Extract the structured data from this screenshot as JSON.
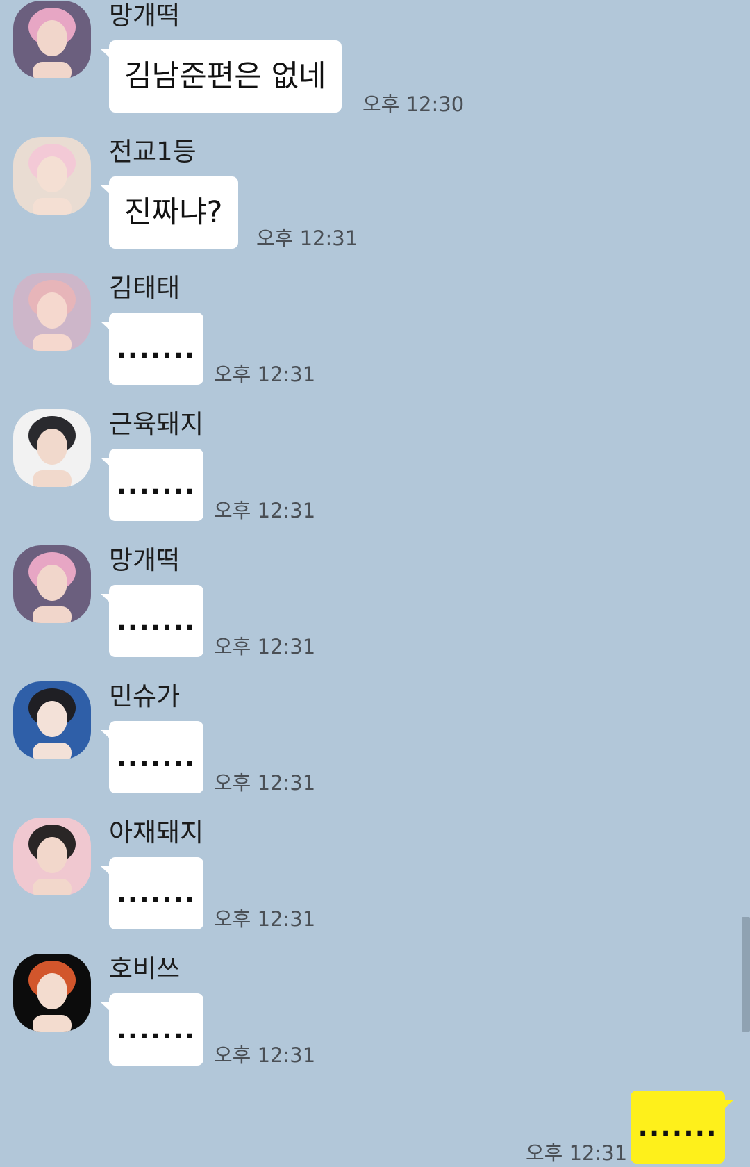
{
  "messages": [
    {
      "sender": "망개떡",
      "text": "김남준편은 없네",
      "time": "오후 12:30",
      "avatar": {
        "bg": "#6b5f7e",
        "hair": "#e7a6c4",
        "skin": "#f1d6cb"
      }
    },
    {
      "sender": "전교1등",
      "text": "진짜냐?",
      "time": "오후 12:31",
      "avatar": {
        "bg": "#e9dcd2",
        "hair": "#f3c9d6",
        "skin": "#f4dfd3"
      }
    },
    {
      "sender": "김태태",
      "text": ".......",
      "time": "오후 12:31",
      "avatar": {
        "bg": "#cdb6c9",
        "hair": "#e7b5b9",
        "skin": "#f5d8ce"
      }
    },
    {
      "sender": "근육돼지",
      "text": ".......",
      "time": "오후 12:31",
      "avatar": {
        "bg": "#f2f2f2",
        "hair": "#2a2a2e",
        "skin": "#f1d9cc"
      }
    },
    {
      "sender": "망개떡",
      "text": ".......",
      "time": "오후 12:31",
      "avatar": {
        "bg": "#6b5f7e",
        "hair": "#e7a6c4",
        "skin": "#f1d6cb"
      }
    },
    {
      "sender": "민슈가",
      "text": ".......",
      "time": "오후 12:31",
      "avatar": {
        "bg": "#2f5fa8",
        "hair": "#1f1f24",
        "skin": "#f3e1d8"
      }
    },
    {
      "sender": "아재돼지",
      "text": ".......",
      "time": "오후 12:31",
      "avatar": {
        "bg": "#f0c8d0",
        "hair": "#2a2626",
        "skin": "#f2d7cb"
      }
    },
    {
      "sender": "호비쓰",
      "text": ".......",
      "time": "오후 12:31",
      "avatar": {
        "bg": "#0c0c0c",
        "hair": "#d2562c",
        "skin": "#f3dccf"
      }
    }
  ],
  "my_message": {
    "text": ".......",
    "time": "오후 12:31"
  },
  "colors": {
    "background": "#b2c7d9",
    "incoming_bubble": "#ffffff",
    "outgoing_bubble": "#fef01b"
  }
}
